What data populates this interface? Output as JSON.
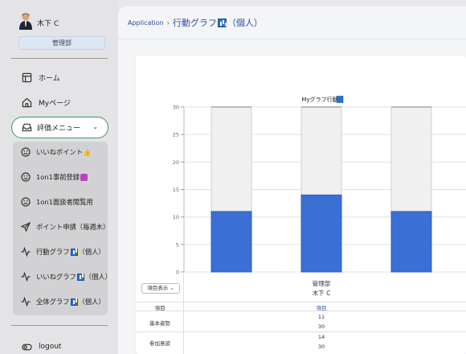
{
  "user": {
    "name": "木下 C",
    "department": "管理部"
  },
  "nav": {
    "home": "ホーム",
    "mypage": "Myページ",
    "eval_menu": "評価メニュー",
    "logout": "logout"
  },
  "submenu": [
    {
      "label": "いいねポイント",
      "icon": "smile-icon",
      "suffix": "👍"
    },
    {
      "label": "1on1事前登録",
      "icon": "smile-icon",
      "suffix": "📝"
    },
    {
      "label": "1on1面談者閲覧用",
      "icon": "smile-icon",
      "suffix": ""
    },
    {
      "label": "ポイント申請（毎週木）",
      "icon": "send-icon",
      "suffix": ""
    },
    {
      "label": "行動グラフ",
      "tail": "（個人）",
      "icon": "activity-icon"
    },
    {
      "label": "いいねグラフ",
      "tail": "（個人）",
      "icon": "activity-icon"
    },
    {
      "label": "全体グラフ",
      "tail": "（個人）",
      "icon": "activity-icon"
    }
  ],
  "breadcrumb": {
    "root": "Application",
    "sep": "›",
    "current": "行動グラフ",
    "current_tail": "（個人）"
  },
  "chart_data": {
    "type": "bar",
    "title": "Myグラフ行動",
    "ylim": [
      0,
      30
    ],
    "yticks": [
      0,
      5,
      10,
      15,
      20,
      25,
      30
    ],
    "categories": [
      "",
      "",
      ""
    ],
    "series": [
      {
        "values": [
          11,
          14,
          11
        ],
        "color": "#3a6fd6"
      },
      {
        "values": [
          30,
          30,
          30
        ],
        "color": "#f0f0f0"
      }
    ],
    "grid": true
  },
  "table": {
    "toggle_label": "項目表示 ⌄",
    "dept_header": "管理部",
    "name_header": "木下 C",
    "col_label_header": "項目",
    "col_value_header": "項目",
    "rows": [
      {
        "label": "基本姿勢",
        "values": [
          "11",
          "30"
        ]
      },
      {
        "label": "参加意欲",
        "values": [
          "14",
          "30"
        ]
      }
    ]
  },
  "colors": {
    "accent": "#2a4fa0",
    "menu_border": "#3a9a5a",
    "bar_fill": "#3a6fd6"
  }
}
